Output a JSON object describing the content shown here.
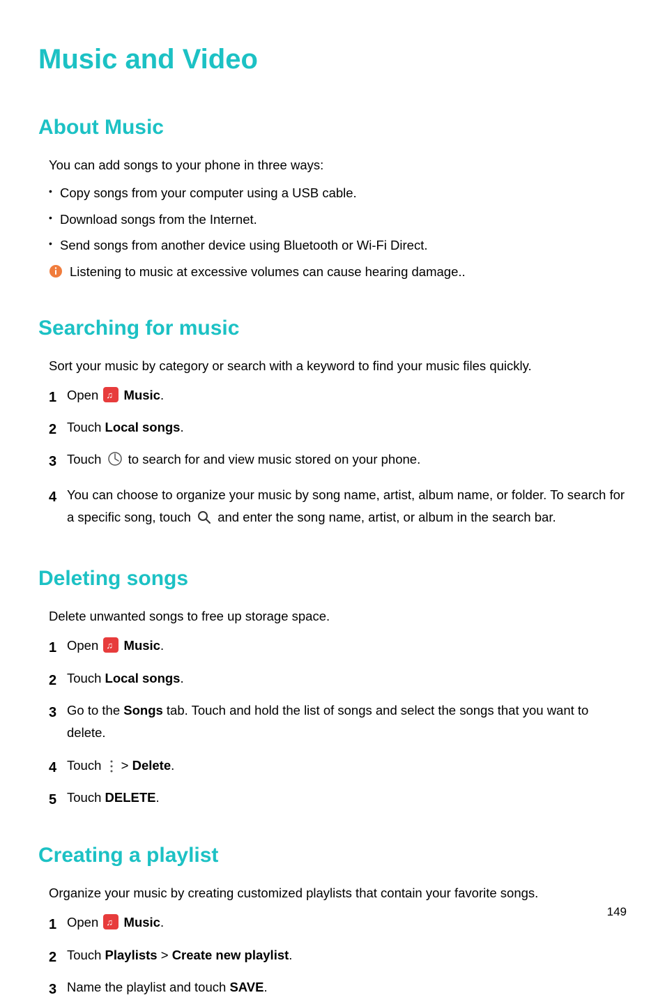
{
  "page": {
    "title": "Music and Video",
    "number": "149"
  },
  "section1": {
    "heading": "About Music",
    "intro": "You can add songs to your phone in three ways:",
    "bullets": [
      "Copy songs from your computer using a USB cable.",
      "Download songs from the Internet.",
      "Send songs from another device using Bluetooth or Wi-Fi Direct."
    ],
    "note": "Listening to music at excessive volumes can cause hearing damage.."
  },
  "section2": {
    "heading": "Searching for music",
    "intro": "Sort your music by category or search with a keyword to find your music files quickly.",
    "steps": {
      "s1_a": "Open ",
      "s1_b": "Music",
      "s1_c": ".",
      "s2_a": "Touch ",
      "s2_b": "Local songs",
      "s2_c": ".",
      "s3_a": "Touch ",
      "s3_b": " to search for and view music stored on your phone.",
      "s4_a": "You can choose to organize your music by song name, artist, album name, or folder. To search for a specific song, touch ",
      "s4_b": " and enter the song name, artist, or album in the search bar."
    }
  },
  "section3": {
    "heading": "Deleting songs",
    "intro": "Delete unwanted songs to free up storage space.",
    "steps": {
      "s1_a": "Open ",
      "s1_b": "Music",
      "s1_c": ".",
      "s2_a": "Touch ",
      "s2_b": "Local songs",
      "s2_c": ".",
      "s3_a": "Go to the ",
      "s3_b": "Songs",
      "s3_c": " tab. Touch and hold the list of songs and select the songs that you want to delete.",
      "s4_a": "Touch ",
      "s4_b": " > ",
      "s4_c": "Delete",
      "s4_d": ".",
      "s5_a": "Touch ",
      "s5_b": "DELETE",
      "s5_c": "."
    }
  },
  "section4": {
    "heading": "Creating a playlist",
    "intro": "Organize your music by creating customized playlists that contain your favorite songs.",
    "steps": {
      "s1_a": "Open ",
      "s1_b": "Music",
      "s1_c": ".",
      "s2_a": "Touch ",
      "s2_b": "Playlists",
      "s2_c": " > ",
      "s2_d": "Create new playlist",
      "s2_e": ".",
      "s3_a": "Name the playlist and touch ",
      "s3_b": "SAVE",
      "s3_c": "."
    }
  }
}
